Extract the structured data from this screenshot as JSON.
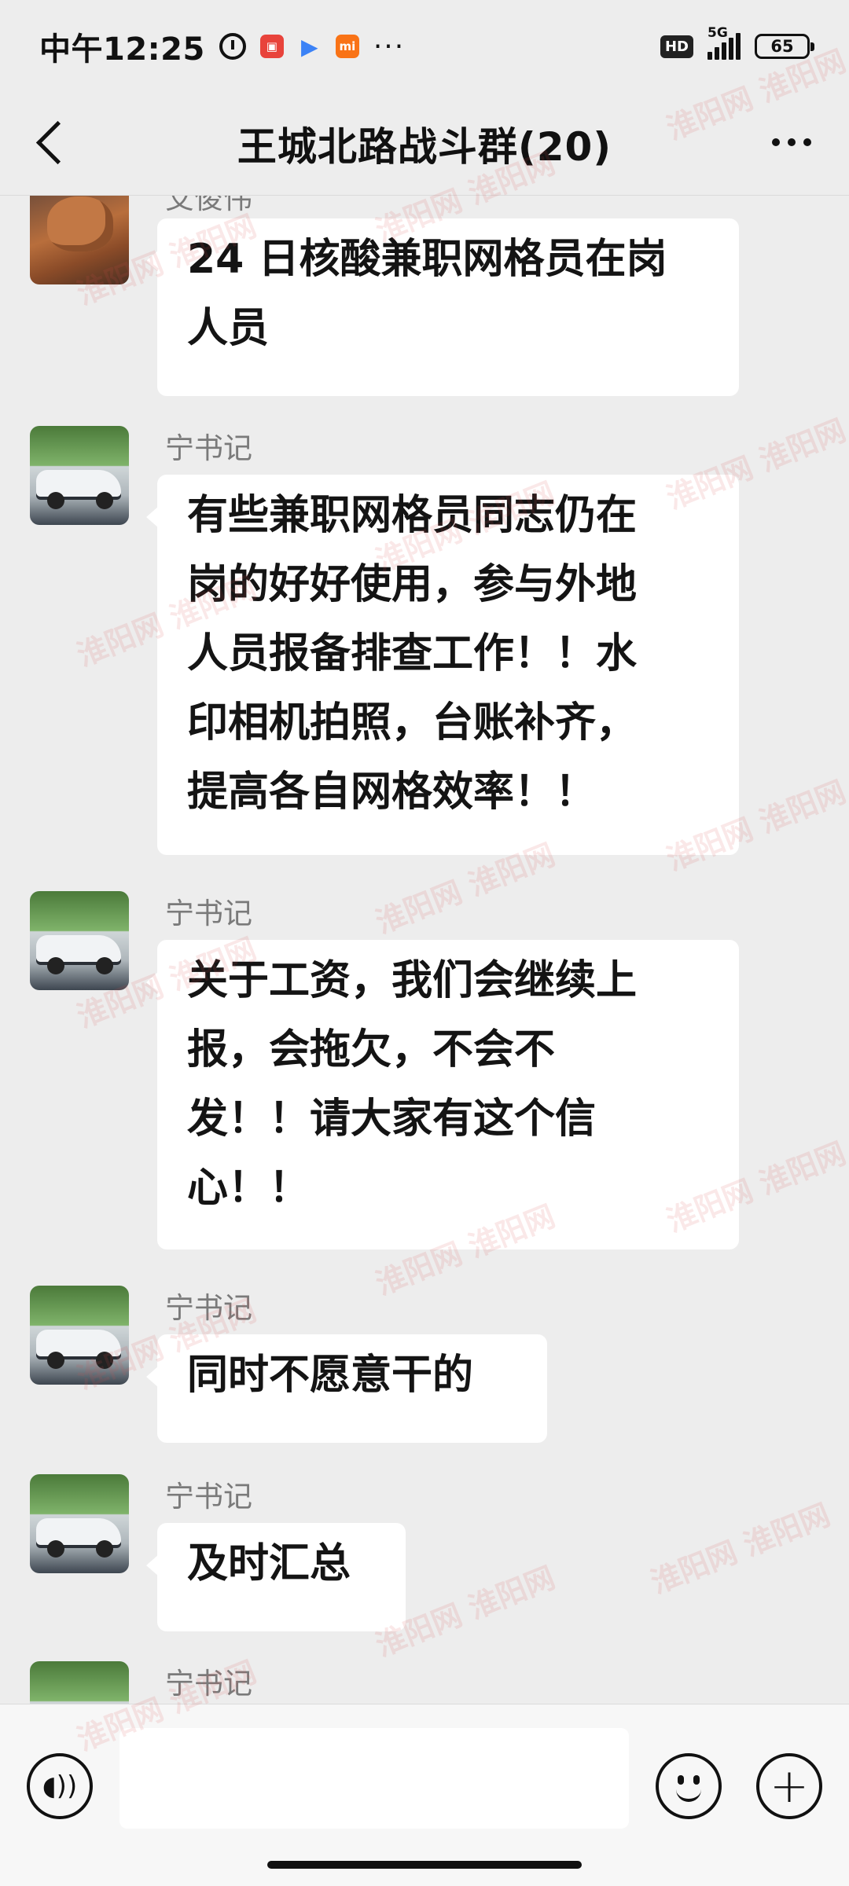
{
  "status_bar": {
    "time": "中午12:25",
    "app_icons": [
      "red-app-icon",
      "play-icon",
      "mi-icon"
    ],
    "more": "···",
    "hd": "HD",
    "network": "5G",
    "battery": "65"
  },
  "header": {
    "title": "王城北路战斗群(20)"
  },
  "messages": [
    {
      "sender": "艾俊伟",
      "avatar": "teapot-avatar",
      "text": "24 日核酸兼职网格员在岗\n人员"
    },
    {
      "sender": "宁书记",
      "avatar": "car-avatar",
      "text": "有些兼职网格员同志仍在\n岗的好好使用，参与外地\n人员报备排查工作！！水\n印相机拍照，台账补齐，\n提高各自网格效率！！"
    },
    {
      "sender": "宁书记",
      "avatar": "car-avatar",
      "text": "关于工资，我们会继续上\n报，会拖欠，不会不\n发！！请大家有这个信\n心！！"
    },
    {
      "sender": "宁书记",
      "avatar": "car-avatar",
      "text": "同时不愿意干的"
    },
    {
      "sender": "宁书记",
      "avatar": "car-avatar",
      "text": "及时汇总"
    },
    {
      "sender": "宁书记",
      "avatar": "car-avatar",
      "text": ""
    }
  ],
  "input": {
    "value": "",
    "placeholder": ""
  },
  "watermark": "淮阳网 淮阳网"
}
